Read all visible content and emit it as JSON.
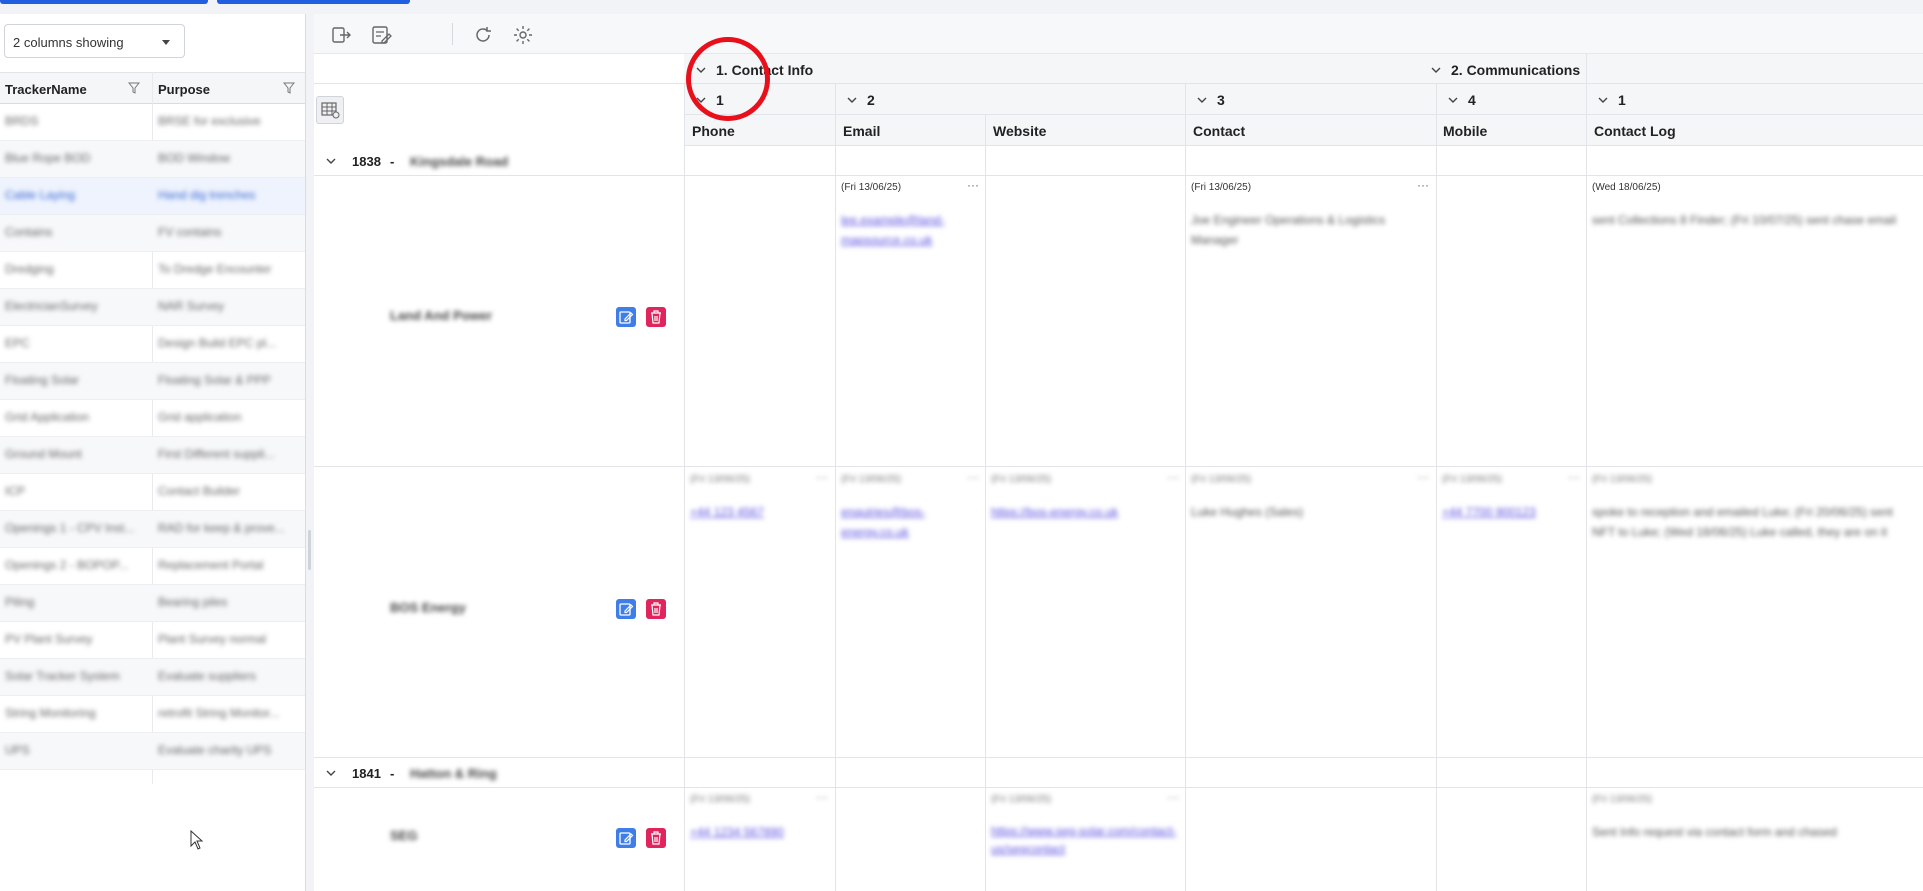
{
  "left_panel": {
    "column_select": "2 columns showing",
    "headers": [
      "TrackerName",
      "Purpose"
    ],
    "rows": [
      {
        "name": "BRDS",
        "purpose": "BRSE for exclusive"
      },
      {
        "name": "Blue Rope BOD",
        "purpose": "BOD Window"
      },
      {
        "name": "Cable Laying",
        "purpose": "Hand dig trenches"
      },
      {
        "name": "Contains",
        "purpose": "FV contains"
      },
      {
        "name": "Dredging",
        "purpose": "To Dredge Encounter"
      },
      {
        "name": "ElectricianSurvey",
        "purpose": "NAR Survey"
      },
      {
        "name": "EPC",
        "purpose": "Design Build EPC pl..."
      },
      {
        "name": "Floating Solar",
        "purpose": "Floating Solar & PPP"
      },
      {
        "name": "Grid Application",
        "purpose": "Grid application"
      },
      {
        "name": "Ground Mount",
        "purpose": "First Different suppli..."
      },
      {
        "name": "ICP",
        "purpose": "Contact Builder"
      },
      {
        "name": "Openings 1 - CPV Inst...",
        "purpose": "RAD for keep & prove..."
      },
      {
        "name": "Openings 2 - BOPOP...",
        "purpose": "Replacement Portal"
      },
      {
        "name": "Piling",
        "purpose": "Bearing piles"
      },
      {
        "name": "PV Plant Survey",
        "purpose": "Plant Survey normal"
      },
      {
        "name": "Solar Tracker System",
        "purpose": "Evaluate suppliers"
      },
      {
        "name": "String Monitoring",
        "purpose": "retrofit String Monitor..."
      },
      {
        "name": "UPS",
        "purpose": "Evaluate charity UPS"
      }
    ],
    "selected_index": 2
  },
  "grid": {
    "group_headers": [
      {
        "label": "1. Contact Info"
      },
      {
        "label": "2. Communications"
      }
    ],
    "sub_headers": [
      "1",
      "2",
      "3",
      "4",
      "1"
    ],
    "columns": [
      "Phone",
      "Email",
      "Website",
      "Contact",
      "Mobile",
      "Contact Log"
    ],
    "groups": [
      {
        "id": "1838",
        "sep": " - ",
        "name": "Kingsdale Road"
      },
      {
        "id": "1841",
        "sep": " - ",
        "name": "Hatton & Ring"
      }
    ],
    "rows": [
      {
        "name": "Land And Power",
        "cells": {
          "email": {
            "date": "(Fri 13/06/25)",
            "text": "lee.example@land-mapsource.co.uk",
            "link": true
          },
          "contact": {
            "date": "(Fri 13/06/25)",
            "text": "Joe Engineer Operations & Logistics Manager"
          },
          "log": {
            "date": "(Wed 18/06/25)",
            "text": "sent Collections 8 Finder; (Fri 10/07/25) sent chase email"
          }
        }
      },
      {
        "name": "BOS Energy",
        "cells": {
          "phone": {
            "date": "(Fri 13/06/25)",
            "text": "+44 123 4567",
            "link": true
          },
          "email": {
            "date": "(Fri 13/06/25)",
            "text": "enquiries@bos-energy.co.uk",
            "link": true
          },
          "website": {
            "date": "(Fri 13/06/25)",
            "text": "https://bos-energy.co.uk",
            "link": true
          },
          "contact": {
            "date": "(Fri 13/06/25)",
            "text": "Luke Hughes (Sales)"
          },
          "mobile": {
            "date": "(Fri 13/06/25)",
            "text": "+44 7700 900123",
            "link": true
          },
          "log": {
            "date": "(Fri 13/06/25)",
            "text": "spoke to reception and emailed Luke; (Fri 20/06/25) sent NFT to Luke; (Wed 18/06/25) Luke called, they are on it"
          }
        }
      },
      {
        "name": "SEG",
        "cells": {
          "phone": {
            "date": "(Fri 13/06/25)",
            "text": "+44 1234 567890",
            "link": true
          },
          "website": {
            "date": "(Fri 13/06/25)",
            "text": "https://www.seg-solar.com/contact-us/segcontact",
            "link": true
          },
          "log": {
            "date": "(Fri 13/06/25)",
            "text": "Sent Info request via contact form and chased"
          }
        }
      }
    ]
  },
  "colors": {
    "accent": "#1f5fe0",
    "edit": "#3f7ee8",
    "delete": "#e0245e",
    "highlight": "#e8101a"
  },
  "icons": [
    "logout-icon",
    "edit-note-icon",
    "refresh-icon",
    "gear-icon",
    "grid-settings-icon",
    "filter-icon",
    "chevron-down-icon",
    "edit-icon",
    "trash-icon"
  ]
}
